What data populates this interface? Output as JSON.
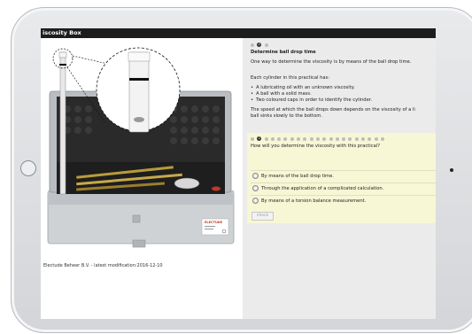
{
  "window": {
    "title": "iscosity Box"
  },
  "footer": {
    "credit": "Electude Beheer B.V. - latest modification:2016-12-10"
  },
  "product": {
    "label": "ELECTUDE"
  },
  "content": {
    "progress_step": "2",
    "heading": "Determine ball drop time",
    "intro": "One way to determine the viscosity is by means of the ball drop time.",
    "cylinder_intro": "Each cylinder in this practical has:",
    "bullets": [
      "A lubricating oil with an unknown viscosity.",
      "A ball with a solid mass.",
      "Two coloured caps in order to identify the cylinder."
    ],
    "speed_line1": "The speed at which the ball drops down depends on the viscosity of a li",
    "speed_line2": "ball sinks slowly to the bottom."
  },
  "question": {
    "progress_step": "2",
    "text": "How will you determine the viscosity with this practical?",
    "options": [
      "By means of the ball drop time.",
      "Through the application of a complicated calculation.",
      "By means of a torsion balance measurement."
    ],
    "check_label": "check"
  }
}
